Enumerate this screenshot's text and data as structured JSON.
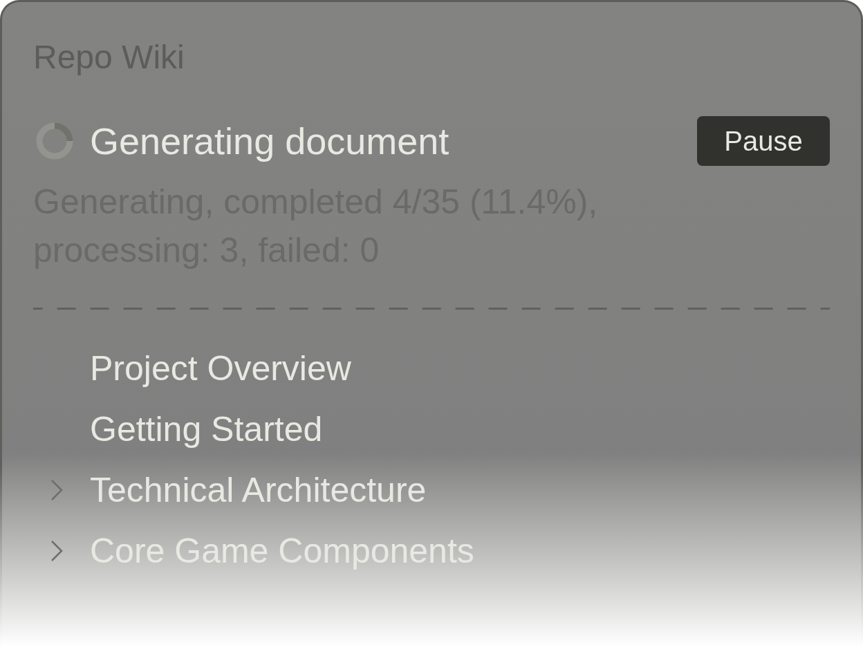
{
  "title": "Repo Wiki",
  "progress": {
    "heading": "Generating document",
    "status": "Generating, completed 4/35 (11.4%), processing: 3, failed: 0",
    "button": "Pause"
  },
  "tree": [
    {
      "label": "Project Overview",
      "kind": "page"
    },
    {
      "label": "Getting Started",
      "kind": "page"
    },
    {
      "label": "Technical Architecture",
      "kind": "section",
      "expanded": false
    },
    {
      "label": "Core Game Components",
      "kind": "section",
      "expanded": false
    }
  ]
}
